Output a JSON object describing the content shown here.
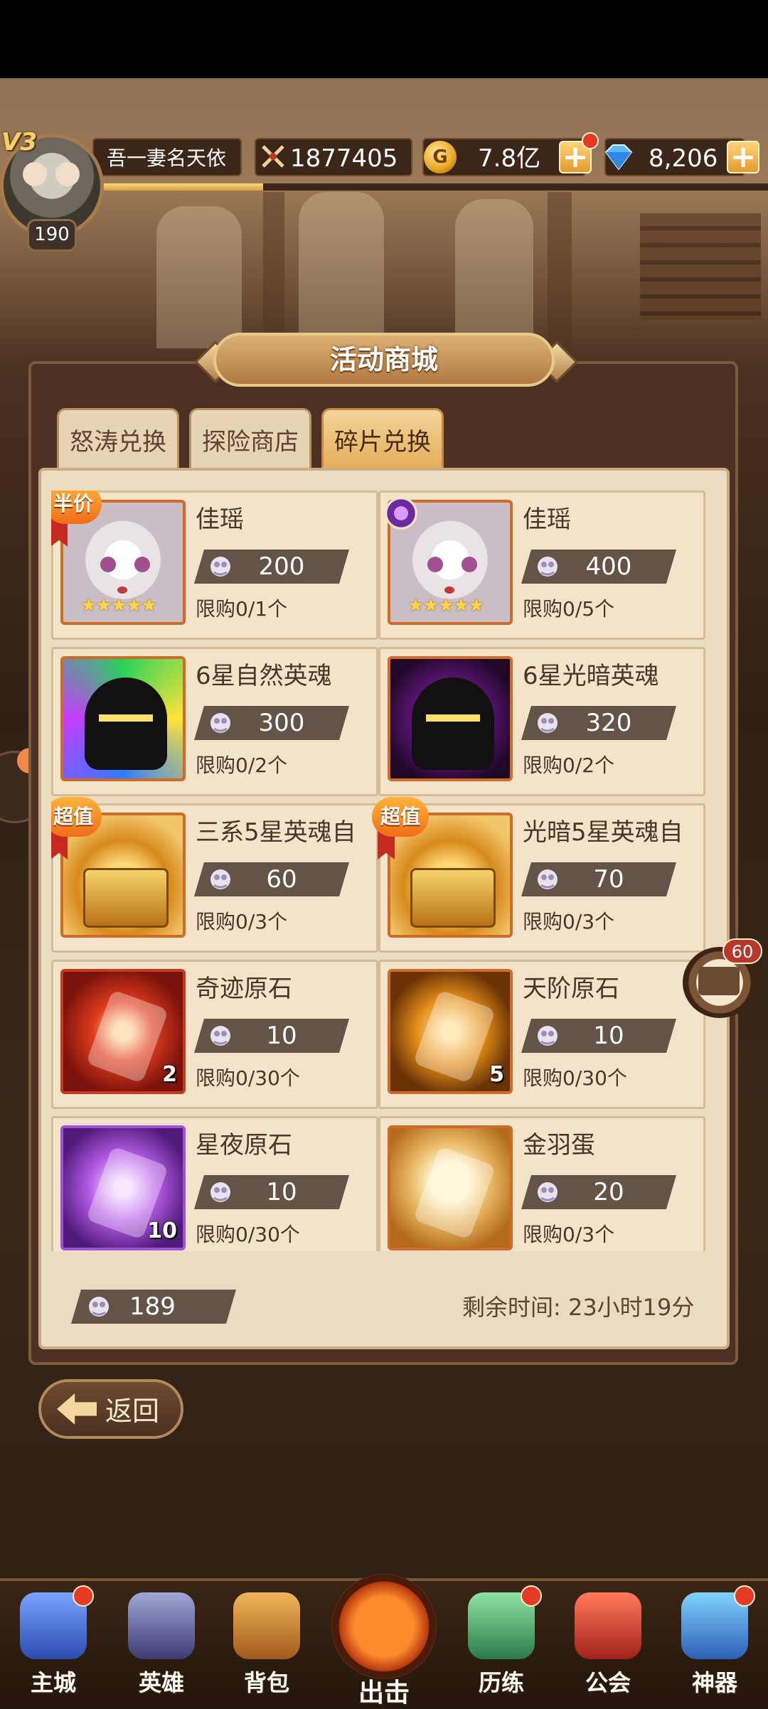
{
  "player": {
    "vip": "V3",
    "level": "190",
    "name": "吾一妻名天依",
    "power": "1877405",
    "gold": "7.8亿",
    "gems": "8,206",
    "exp_fraction": 0.24
  },
  "shop": {
    "title": "活动商城",
    "tabs": [
      {
        "label": "怒涛兑换",
        "active": false
      },
      {
        "label": "探险商店",
        "active": false
      },
      {
        "label": "碎片兑换",
        "active": true
      }
    ],
    "items": [
      {
        "name": "佳瑶",
        "price": "200",
        "limit": "限购0/1个",
        "tag": "半价",
        "art": "girl",
        "stars": "★★★★★"
      },
      {
        "name": "佳瑶",
        "price": "400",
        "limit": "限购0/5个",
        "tag": "",
        "art": "girl",
        "stars": "★★★★★"
      },
      {
        "name": "6星自然英魂",
        "price": "300",
        "limit": "限购0/2个",
        "tag": "",
        "art": "helm-green"
      },
      {
        "name": "6星光暗英魂",
        "price": "320",
        "limit": "限购0/2个",
        "tag": "",
        "art": "helm-purple"
      },
      {
        "name": "三系5星英魂自",
        "price": "60",
        "limit": "限购0/3个",
        "tag": "超值",
        "art": "chest"
      },
      {
        "name": "光暗5星英魂自",
        "price": "70",
        "limit": "限购0/3个",
        "tag": "超值",
        "art": "chest"
      },
      {
        "name": "奇迹原石",
        "price": "10",
        "limit": "限购0/30个",
        "tag": "",
        "art": "red",
        "qty": "2"
      },
      {
        "name": "天阶原石",
        "price": "10",
        "limit": "限购0/30个",
        "tag": "",
        "art": "amber",
        "qty": "5"
      },
      {
        "name": "星夜原石",
        "price": "10",
        "limit": "限购0/30个",
        "tag": "",
        "art": "violet",
        "qty": "10"
      },
      {
        "name": "金羽蛋",
        "price": "20",
        "limit": "限购0/3个",
        "tag": "",
        "art": "gold"
      }
    ],
    "owned": "189",
    "time_left": "剩余时间: 23小时19分"
  },
  "back_label": "返回",
  "chat_badge": "60",
  "nav": [
    {
      "label": "主城",
      "dot": true
    },
    {
      "label": "英雄",
      "dot": false
    },
    {
      "label": "背包",
      "dot": false
    },
    {
      "label": "出击",
      "dot": false
    },
    {
      "label": "历练",
      "dot": true
    },
    {
      "label": "公会",
      "dot": false
    },
    {
      "label": "神器",
      "dot": true
    }
  ],
  "colors": {
    "panel": "#4c3123",
    "card": "#f3e4c9",
    "price_pill": "#645447",
    "accent": "#e4ae5a",
    "badge_red": "#e43a24"
  }
}
